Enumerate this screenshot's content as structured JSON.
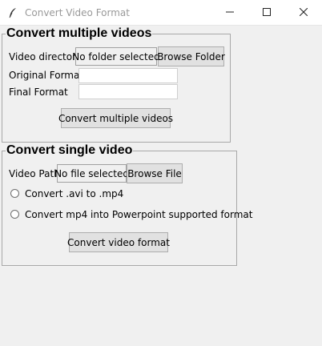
{
  "window": {
    "title": "Convert Video Format",
    "app_icon": "feather-icon",
    "controls": [
      "minimize-icon",
      "maximize-icon",
      "close-icon"
    ]
  },
  "multiple": {
    "group_title": "Convert multiple videos",
    "video_directory_label": "Video directory",
    "folder_status": "No folder selected",
    "browse_folder_button": "Browse Folder",
    "original_format_label": "Original Format",
    "original_format_value": "",
    "final_format_label": "Final Format",
    "final_format_value": "",
    "convert_button": "Convert multiple videos"
  },
  "single": {
    "group_title": "Convert single video",
    "video_path_label": "Video Path",
    "file_status": "No file selected",
    "browse_file_button": "Browse File",
    "radio_options": [
      {
        "label": "Convert .avi to .mp4",
        "selected": false
      },
      {
        "label": "Convert mp4 into Powerpoint supported format",
        "selected": false
      }
    ],
    "convert_button": "Convert video format"
  }
}
